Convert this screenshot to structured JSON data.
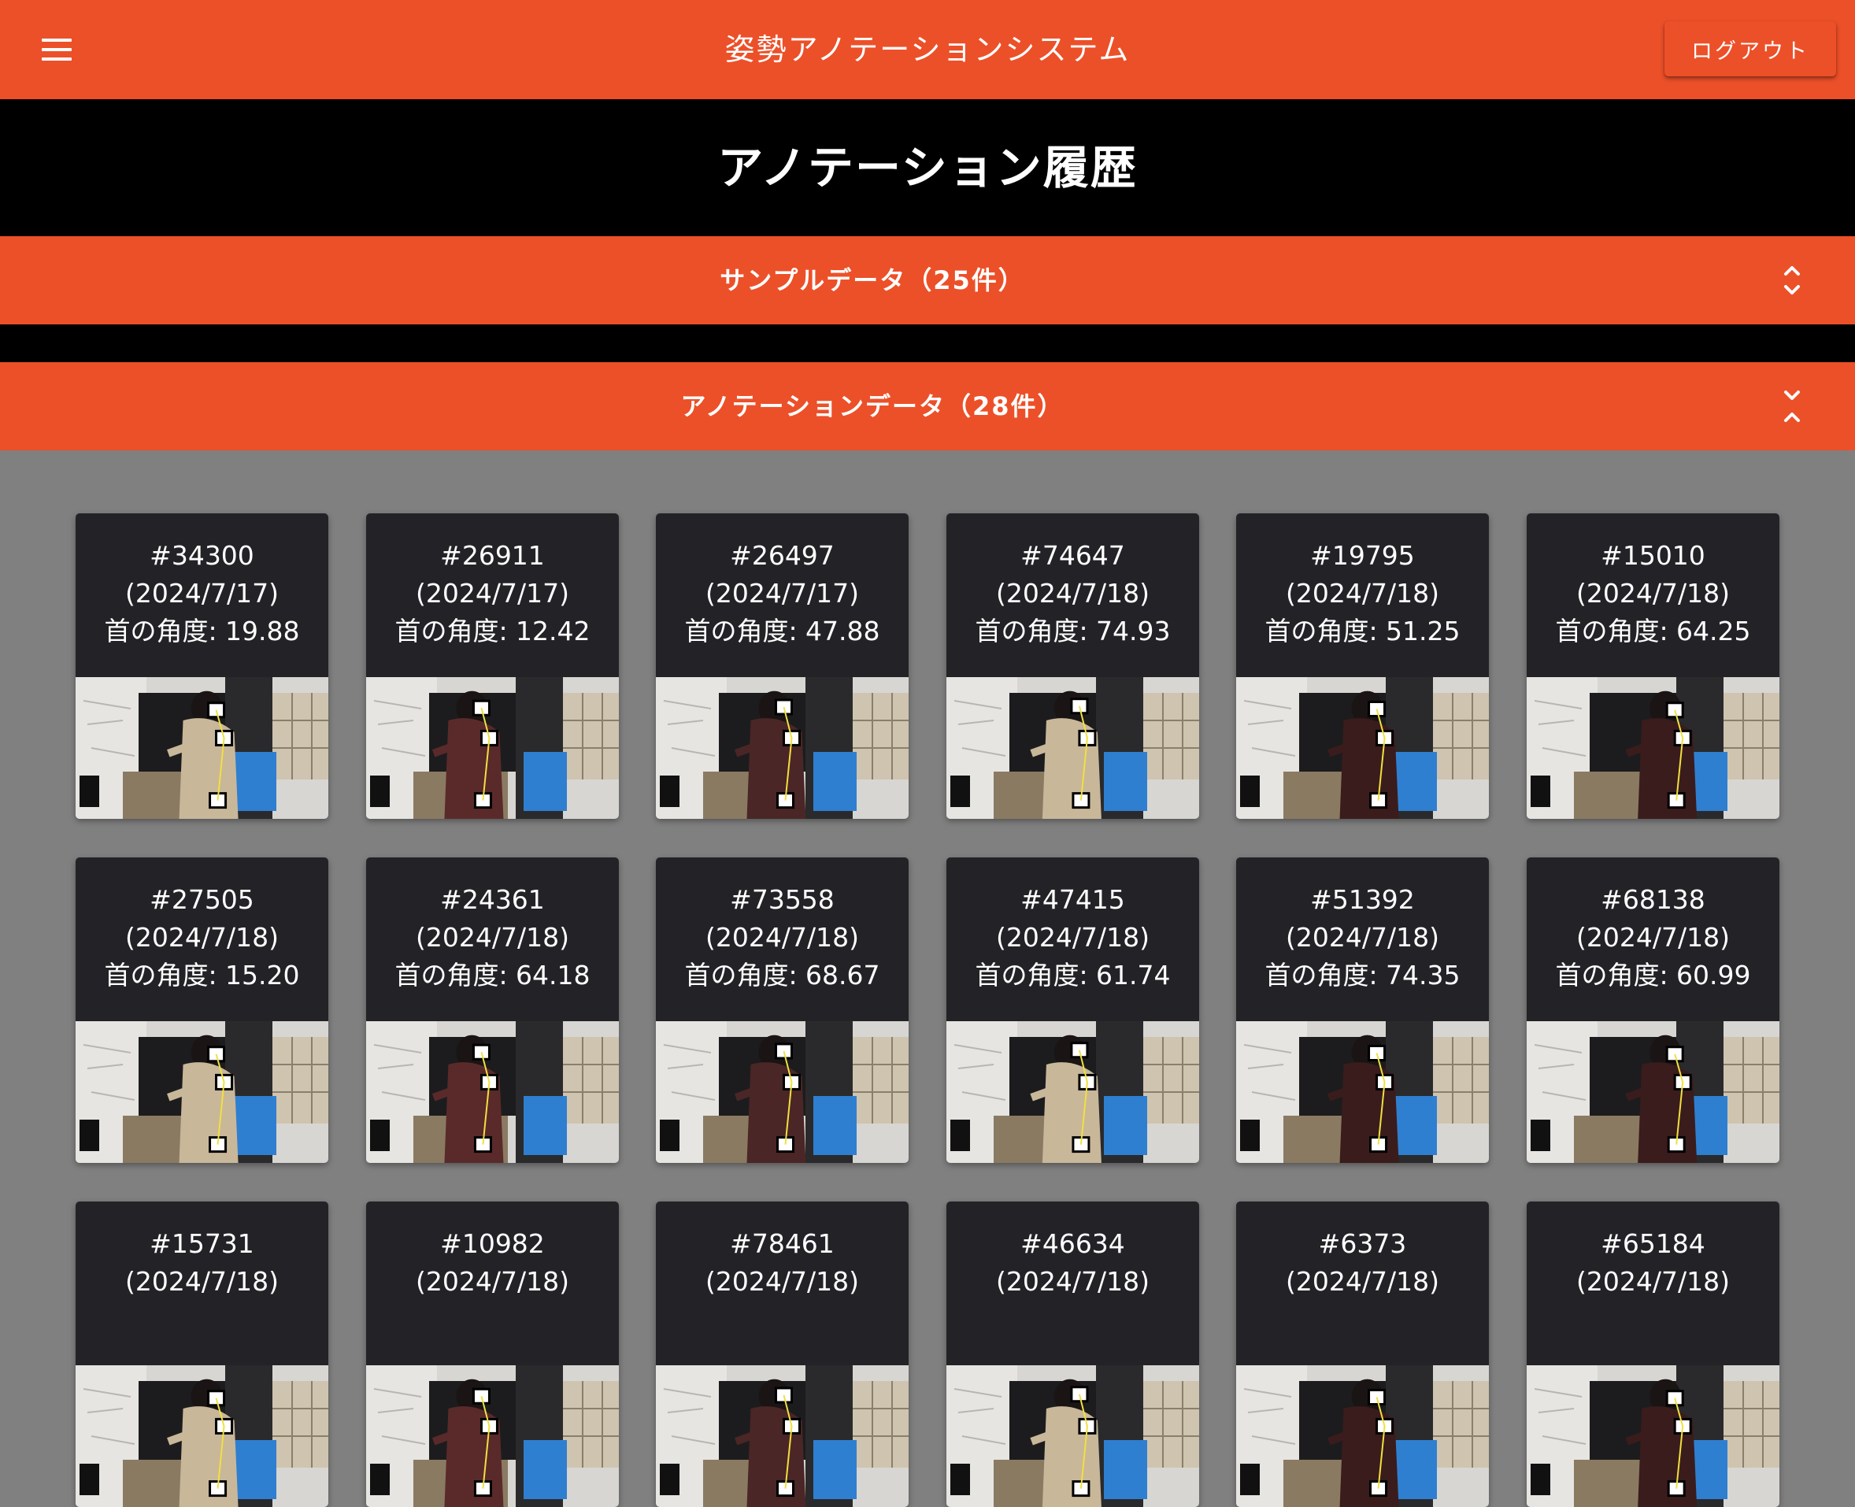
{
  "app_bar": {
    "title": "姿勢アノテーションシステム",
    "logout_label": "ログアウト"
  },
  "page": {
    "heading": "アノテーション履歴"
  },
  "sections": {
    "sample": {
      "label": "サンプルデータ（25件）",
      "icon": "unfold-more-icon"
    },
    "annotation": {
      "label": "アノテーションデータ（28件）",
      "icon": "unfold-less-icon"
    }
  },
  "colors": {
    "accent": "#ec5029",
    "card_bg": "#232226",
    "page_bg": "#808080"
  },
  "cards": [
    {
      "id": "#34300",
      "date": "(2024/7/17)",
      "angle": "首の角度: 19.88"
    },
    {
      "id": "#26911",
      "date": "(2024/7/17)",
      "angle": "首の角度: 12.42"
    },
    {
      "id": "#26497",
      "date": "(2024/7/17)",
      "angle": "首の角度: 47.88"
    },
    {
      "id": "#74647",
      "date": "(2024/7/18)",
      "angle": "首の角度: 74.93"
    },
    {
      "id": "#19795",
      "date": "(2024/7/18)",
      "angle": "首の角度: 51.25"
    },
    {
      "id": "#15010",
      "date": "(2024/7/18)",
      "angle": "首の角度: 64.25"
    },
    {
      "id": "#27505",
      "date": "(2024/7/18)",
      "angle": "首の角度: 15.20"
    },
    {
      "id": "#24361",
      "date": "(2024/7/18)",
      "angle": "首の角度: 64.18"
    },
    {
      "id": "#73558",
      "date": "(2024/7/18)",
      "angle": "首の角度: 68.67"
    },
    {
      "id": "#47415",
      "date": "(2024/7/18)",
      "angle": "首の角度: 61.74"
    },
    {
      "id": "#51392",
      "date": "(2024/7/18)",
      "angle": "首の角度: 74.35"
    },
    {
      "id": "#68138",
      "date": "(2024/7/18)",
      "angle": "首の角度: 60.99"
    },
    {
      "id": "#15731",
      "date": "(2024/7/18)",
      "angle": ""
    },
    {
      "id": "#10982",
      "date": "(2024/7/18)",
      "angle": ""
    },
    {
      "id": "#78461",
      "date": "(2024/7/18)",
      "angle": ""
    },
    {
      "id": "#46634",
      "date": "(2024/7/18)",
      "angle": ""
    },
    {
      "id": "#6373",
      "date": "(2024/7/18)",
      "angle": ""
    },
    {
      "id": "#65184",
      "date": "(2024/7/18)",
      "angle": ""
    }
  ]
}
